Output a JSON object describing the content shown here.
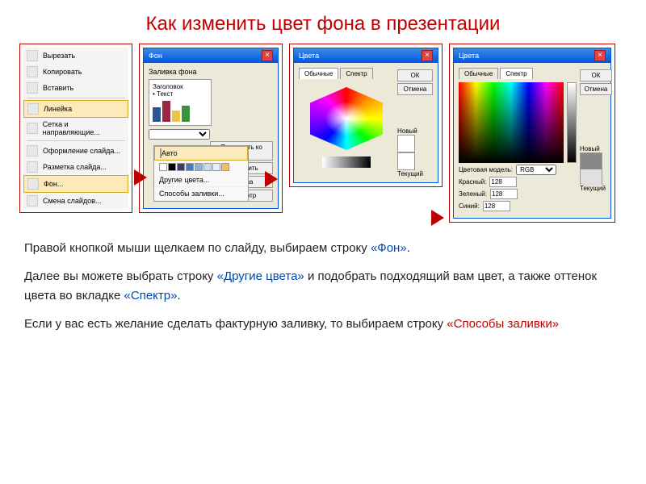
{
  "title": "Как изменить цвет фона в презентации",
  "contextMenu": {
    "items": [
      {
        "label": "Вырезать"
      },
      {
        "label": "Копировать"
      },
      {
        "label": "Вставить"
      },
      {
        "label": "Линейка"
      },
      {
        "label": "Сетка и направляющие..."
      },
      {
        "label": "Оформление слайда..."
      },
      {
        "label": "Разметка слайда..."
      },
      {
        "label": "Фон...",
        "hl": true
      },
      {
        "label": "Смена слайдов..."
      }
    ]
  },
  "fillDialog": {
    "title": "Фон",
    "section": "Заливка фона",
    "preview_title": "Заголовок",
    "preview_sub": "• Текст",
    "buttons": {
      "applyAll": "Применить ко всем",
      "apply": "Применить",
      "cancel": "Отмена",
      "preview": "Просмотр"
    }
  },
  "dropdown": {
    "auto": "Авто",
    "moreColors": "Другие цвета...",
    "fillEffects": "Способы заливки...",
    "swatches": [
      "#ffffff",
      "#000000",
      "#3b3b6d",
      "#4a7ab8",
      "#8bb3d9",
      "#c9dced",
      "#e6effa",
      "#f2c063"
    ]
  },
  "colorDlgStd": {
    "title": "Цвета",
    "tab1": "Обычные",
    "tab2": "Спектр",
    "ok": "ОК",
    "cancel": "Отмена",
    "new": "Новый",
    "current": "Текущий"
  },
  "colorDlgSpec": {
    "title": "Цвета",
    "tab1": "Обычные",
    "tab2": "Спектр",
    "ok": "ОК",
    "cancel": "Отмена",
    "model_label": "Цветовая модель:",
    "model": "RGB",
    "r_label": "Красный:",
    "r": "128",
    "g_label": "Зеленый:",
    "g": "128",
    "b_label": "Синий:",
    "b": "128",
    "new": "Новый",
    "current": "Текущий"
  },
  "desc": {
    "p1a": "Правой кнопкой мыши щелкаем по слайду, выбираем строку ",
    "p1b": "«Фон»",
    "p1c": ".",
    "p2a": "Далее вы можете выбрать строку ",
    "p2b": "«Другие цвета»",
    "p2c": " и подобрать подходящий вам цвет, а также оттенок цвета во вкладке ",
    "p2d": "«Спектр»",
    "p2e": ".",
    "p3a": "Если у вас есть желание сделать фактурную заливку, то выбираем строку ",
    "p3b": "«Способы заливки»"
  }
}
